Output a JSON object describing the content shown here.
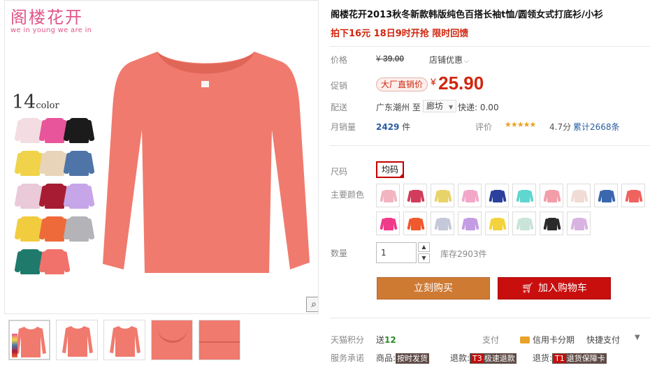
{
  "brand": {
    "name_zh": "阁楼花开",
    "slogan_en": "we in young we are in"
  },
  "gallery": {
    "color_count": "14",
    "color_count_label": "color",
    "zoom_icon": "magnifier-icon",
    "swatch_colors": [
      "#f3dde2",
      "#e8559b",
      "#1b1b1b",
      "#f0d34a",
      "#e8d4b8",
      "#4e74a8",
      "#eac9d9",
      "#a81c33",
      "#c6a6e8",
      "#f2cc3f",
      "#ee6a3b",
      "#b3b3b8",
      "#1f7a6c",
      "#f0726a"
    ],
    "main_color": "#f07a6e",
    "thumbnails": [
      "thumb-1",
      "thumb-2",
      "thumb-3",
      "thumb-4",
      "thumb-5"
    ]
  },
  "product": {
    "title": "阁楼花开2013秋冬新款韩版纯色百搭长袖t恤/圆领女式打底衫/小衫",
    "subtitle": "拍下16元 18日9时开抢 限时回馈"
  },
  "price": {
    "label": "价格",
    "original_symbol": "¥",
    "original": "39.00",
    "shop_discount": "店铺优惠"
  },
  "promo": {
    "label": "促销",
    "badge": "大厂直销价",
    "symbol": "¥",
    "price": "25.90"
  },
  "shipping": {
    "label": "配送",
    "from": "广东潮州 至",
    "to": "廊坊",
    "fee": "快递: 0.00"
  },
  "sales": {
    "label": "月销量",
    "count": "2429",
    "unit": "件",
    "rating_label": "评价",
    "stars": "★★★★★",
    "rating": "4.7分",
    "review_link": "累计2668条"
  },
  "size": {
    "label": "尺码",
    "option": "均码"
  },
  "colors": {
    "label": "主要颜色",
    "options": [
      "#f2b5c0",
      "#d23c5c",
      "#e8d36a",
      "#f2a7c9",
      "#2b3f9c",
      "#5fd6cf",
      "#f29da8",
      "#f0dcd4",
      "#3a67ad",
      "#f0625e",
      "#f03a8a",
      "#f0582e",
      "#c5c8d8",
      "#c49ce4",
      "#f4d23c",
      "#c9e4d8",
      "#2a2a2a",
      "#d8b2e0"
    ]
  },
  "quantity": {
    "label": "数量",
    "value": "1",
    "stock": "库存2903件"
  },
  "actions": {
    "buy_now": "立刻购买",
    "add_to_cart": "加入购物车"
  },
  "footer": {
    "points_label": "天猫积分",
    "points_prefix": "送",
    "points_value": "12",
    "pay_label": "支付",
    "card_pay": "信用卡分期",
    "quick_pay": "快捷支付",
    "service_label": "服务承诺",
    "svc1_prefix": "商品:",
    "svc1_tag": "按时发货",
    "svc2_prefix": "退款:",
    "svc2_code": "T3",
    "svc2_tag": "极速退款",
    "svc3_prefix": "退货:",
    "svc3_code": "T1",
    "svc3_tag": "退货保障卡"
  }
}
